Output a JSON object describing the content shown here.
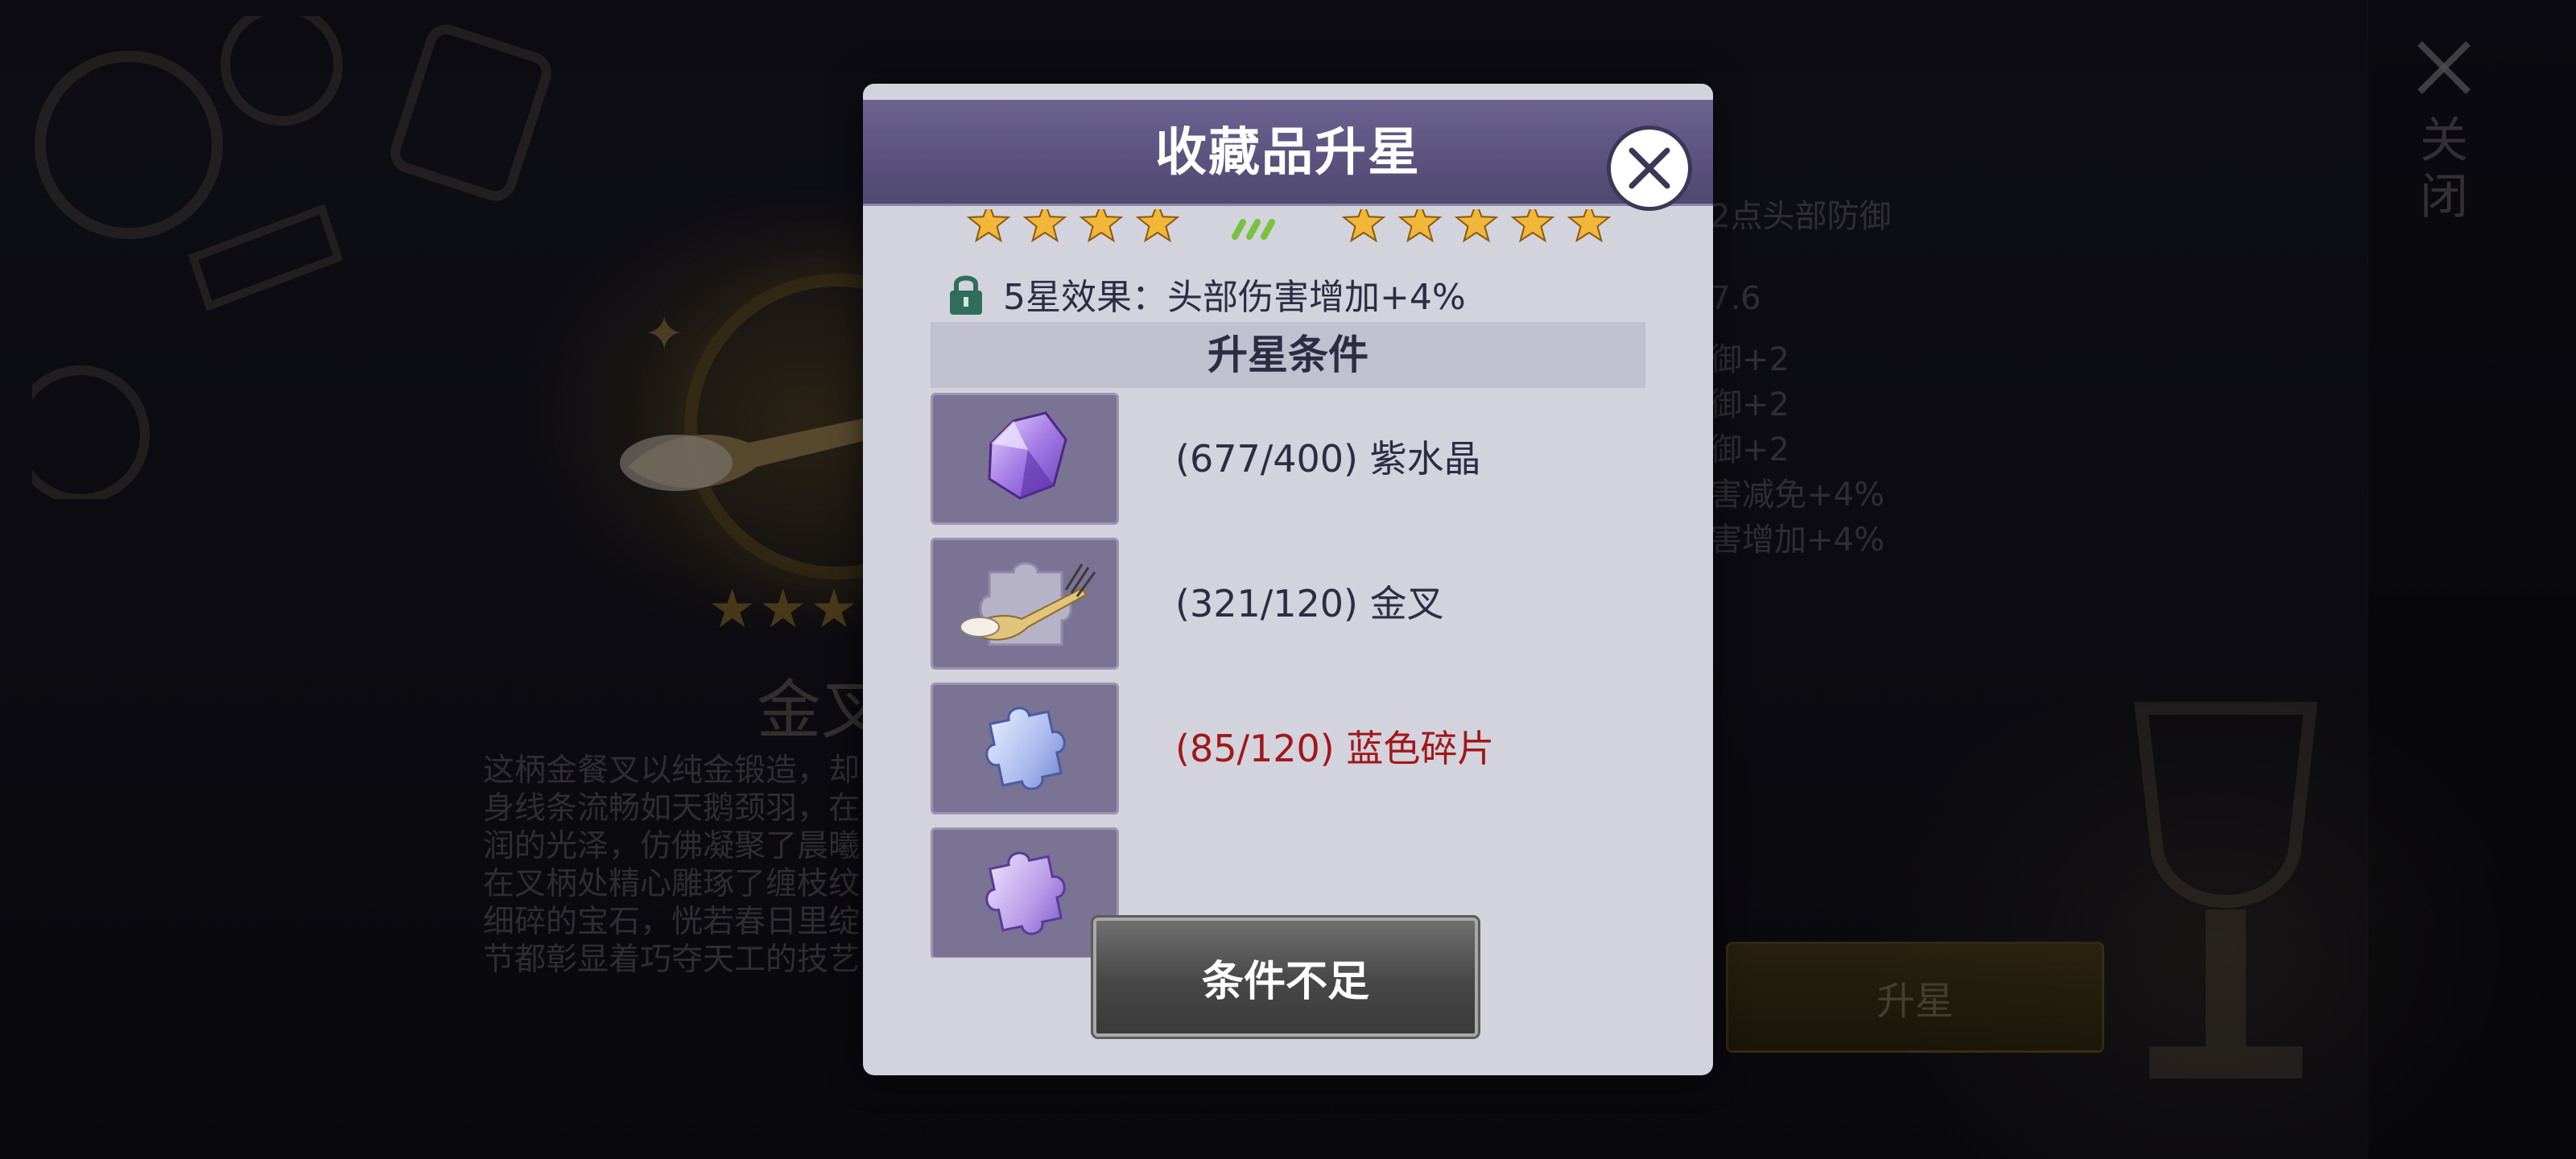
{
  "background": {
    "item_stars": "★★★",
    "item_name": "金叉",
    "description_lines": [
      "这柄金餐叉以纯金锻造，却",
      "身线条流畅如天鹅颈羽，在",
      "润的光泽，仿佛凝聚了晨曦",
      "在叉柄处精心雕琢了缠枝纹",
      "细碎的宝石，恍若春日里绽",
      "节都彰显着巧夺天工的技艺"
    ],
    "stats": [
      "2点头部防御",
      "7.6",
      "御+2",
      "御+2",
      "御+2",
      "害减免+4%",
      "害增加+4%"
    ],
    "star_up_button": "升星",
    "close_label": "关闭",
    "close_icon": "close-x-icon"
  },
  "modal": {
    "title": "收藏品升星",
    "close_icon": "close-x-icon",
    "current_stars": 4,
    "next_stars": 5,
    "star_color": "#f2b638",
    "effect_icon": "lock-icon",
    "effect_text": "5星效果：头部伤害增加+4%",
    "section_title": "升星条件",
    "requirements": [
      {
        "icon": "amethyst-crystal-icon",
        "text": "(677/400) 紫水晶",
        "sufficient": true
      },
      {
        "icon": "golden-fork-icon",
        "text": "(321/120) 金叉",
        "sufficient": true
      },
      {
        "icon": "blue-puzzle-piece-icon",
        "text": "(85/120) 蓝色碎片",
        "sufficient": false
      },
      {
        "icon": "purple-puzzle-piece-icon",
        "text": "",
        "sufficient": true
      }
    ],
    "action_button": "条件不足",
    "colors": {
      "header": "#5a527d",
      "panel": "#d3d3dd",
      "insufficient_text": "#a01818",
      "normal_text": "#2c2c44"
    }
  }
}
